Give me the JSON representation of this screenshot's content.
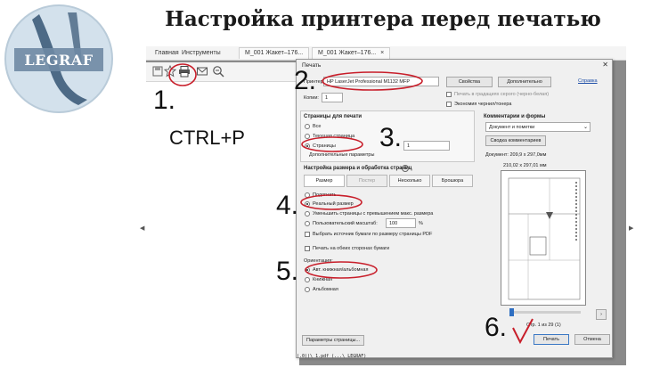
{
  "headline": "Настройка принтера перед печатью",
  "logo": {
    "text": "LEGRAF"
  },
  "app": {
    "menu": [
      "Главная",
      "Инструменты"
    ],
    "doc_tabs": [
      "М_001 Жакет–176...",
      "М_001 Жакет–176..."
    ],
    "tab_close": "×"
  },
  "annotations": {
    "step1": "1.",
    "hotkey": "CTRL+P",
    "step2": "2.",
    "step3": "3.",
    "step4": "4.",
    "step5": "5.",
    "step6": "6."
  },
  "dialog": {
    "title": "Печать",
    "close": "✕",
    "printer_label": "Принтер:",
    "printer_value": "HP LaserJet Professional M1132 MFP",
    "properties_button": "Свойства",
    "advanced_button": "Дополнительно",
    "help_link": "Справка",
    "gray_print": "Печать в градациях серого (черно-белая)",
    "save_ink": "Экономия чернил/тонера",
    "copies_label": "Копии:",
    "copies_value": "1",
    "pages_section": "Страницы для печати",
    "pages_options": [
      "Все",
      "Текущая страница",
      "Страницы"
    ],
    "pages_range_value": "1",
    "more_options": "Дополнительные параметры",
    "size_section": "Настройка размера и обработка страниц",
    "size_tabs": [
      "Размер",
      "Постер",
      "Несколько",
      "Брошюра"
    ],
    "size_options": [
      "Подогнать",
      "Реальный размер",
      "Уменьшить страницы с превышением макс. размера",
      "Пользовательский масштаб:"
    ],
    "scale_value": "100",
    "scale_unit": "%",
    "paper_source": "Выбрать источник бумаги по размеру страницы PDF",
    "duplex": "Печать на обеих сторонах бумаги",
    "orientation_section": "Ориентация:",
    "orientation_options": [
      "Авт. книжная/альбомная",
      "Книжная",
      "Альбомная"
    ],
    "comments_section": "Комментарии и формы",
    "comments_value": "Документ и пометки",
    "comments_button": "Сводка комментариев",
    "doc_size": "Документ: 209,9 x 297,0мм",
    "paper_size": "210,02 x 297,01 мм",
    "page_counter": "Стр. 1 из 29 (1)",
    "page_setup_button": "Параметры страницы...",
    "print_button": "Печать",
    "cancel_button": "Отмена",
    "path_text": "(.0))\\ 1.pdf (...\\ LEGRAF)"
  },
  "colors": {
    "annotation_red": "#c81e2a",
    "logo_circle": "#d3e1ec",
    "logo_dark": "#4d6a86",
    "dialog_bg": "#f0f0f0",
    "app_gray": "#8a8a8a"
  }
}
